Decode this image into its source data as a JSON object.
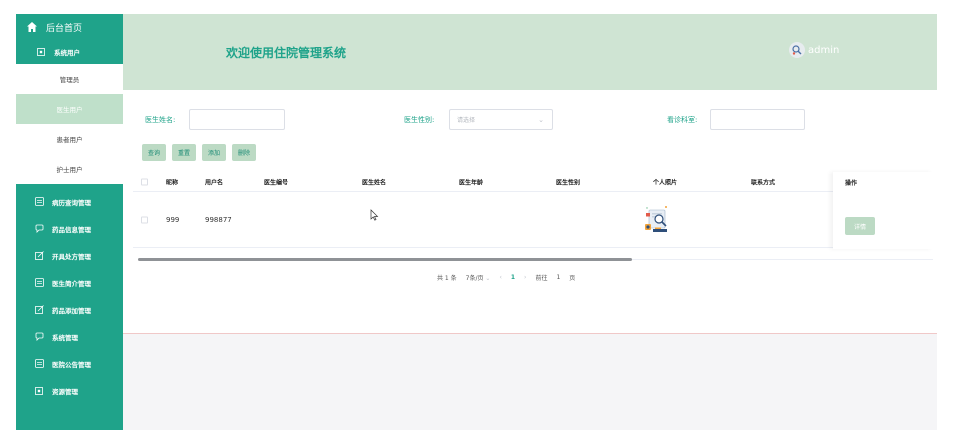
{
  "sidebar": {
    "home": "后台首页",
    "system_user": "系统用户",
    "sub_items": [
      "管理员",
      "医生用户",
      "患者用户",
      "护士用户"
    ],
    "active_sub": "医生用户",
    "groups": [
      "病历查询管理",
      "药品信息管理",
      "开具处方管理",
      "医生简介管理",
      "药品添加管理",
      "系统管理",
      "医院公告管理",
      "资源管理"
    ]
  },
  "header": {
    "title": "欢迎使用住院管理系统",
    "username": "admin"
  },
  "filters": {
    "doctor_name_label": "医生姓名:",
    "doctor_name_value": "",
    "gender_label": "医生性别:",
    "gender_placeholder": "请选择",
    "dept_label": "看诊科室:",
    "dept_value": ""
  },
  "buttons": {
    "query": "查询",
    "reset": "重置",
    "add": "添加",
    "delete": "删除"
  },
  "table": {
    "columns": [
      "昵称",
      "用户名",
      "医生编号",
      "医生姓名",
      "医生年龄",
      "医生性别",
      "个人照片",
      "联系方式",
      "操作"
    ],
    "rows": [
      {
        "nickname": "999",
        "username": "998877",
        "doctor_no": "",
        "doctor_name": "",
        "age": "",
        "gender": "",
        "contact": "",
        "action": "详情"
      }
    ]
  },
  "pagination": {
    "total": "共 1 条",
    "page_size": "7条/页",
    "prev": "‹",
    "current": "1",
    "next": "›",
    "goto_label": "前往",
    "goto_value": "1",
    "page_unit": "页"
  },
  "colors": {
    "primary": "#1fa38a",
    "header_bg": "#cfe4d3",
    "button_bg": "#bcdac4"
  }
}
